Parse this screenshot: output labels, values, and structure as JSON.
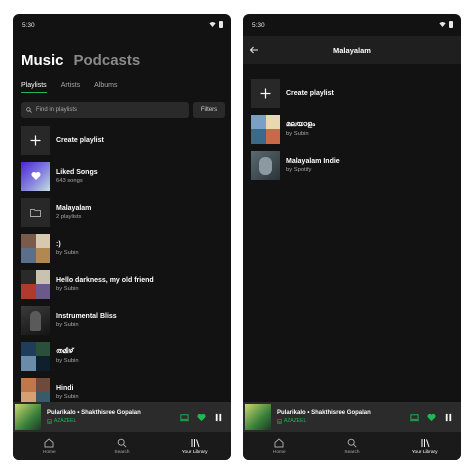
{
  "status_time": "5:30",
  "left": {
    "tabs": [
      "Music",
      "Podcasts"
    ],
    "subtabs": [
      "Playlists",
      "Artists",
      "Albums"
    ],
    "search_placeholder": "Find in playlists",
    "filters_label": "Filters",
    "items": [
      {
        "title": "Create playlist",
        "subtitle": ""
      },
      {
        "title": "Liked Songs",
        "subtitle": "643 songs"
      },
      {
        "title": "Malayalam",
        "subtitle": "2 playlists"
      },
      {
        "title": ":)",
        "subtitle": "by Subin"
      },
      {
        "title": "Hello darkness, my old friend",
        "subtitle": "by Subin"
      },
      {
        "title": "Instrumental Bliss",
        "subtitle": "by Subin"
      },
      {
        "title": "തമിഴ്",
        "subtitle": "by Subin"
      },
      {
        "title": "Hindi",
        "subtitle": "by Subin"
      }
    ]
  },
  "right": {
    "header_title": "Malayalam",
    "items": [
      {
        "title": "Create playlist",
        "subtitle": ""
      },
      {
        "title": "മലയാളം",
        "subtitle": "by Subin"
      },
      {
        "title": "Malayalam Indie",
        "subtitle": "by Spotify"
      }
    ]
  },
  "now_playing": {
    "title": "Pularikalo • Shakthisree Gopalan",
    "device": "AZAZEEL",
    "progress": 0.63
  },
  "nav": [
    "Home",
    "Search",
    "Your Library"
  ],
  "colors": {
    "accent": "#1db954",
    "background": "#121212"
  }
}
